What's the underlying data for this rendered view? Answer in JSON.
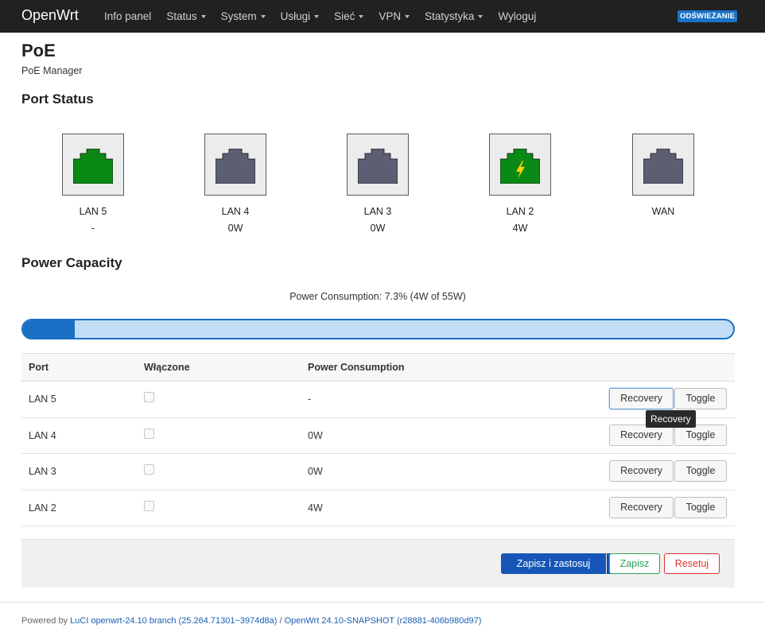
{
  "brand": "OpenWrt",
  "nav": [
    {
      "label": "Info panel",
      "dropdown": false
    },
    {
      "label": "Status",
      "dropdown": true
    },
    {
      "label": "System",
      "dropdown": true
    },
    {
      "label": "Usługi",
      "dropdown": true
    },
    {
      "label": "Sieć",
      "dropdown": true
    },
    {
      "label": "VPN",
      "dropdown": true
    },
    {
      "label": "Statystyka",
      "dropdown": true
    },
    {
      "label": "Wyloguj",
      "dropdown": false
    }
  ],
  "refresh_badge": "ODŚWIEŻANIE",
  "page": {
    "title": "PoE",
    "description": "PoE Manager"
  },
  "port_status": {
    "title": "Port Status",
    "ports": [
      {
        "name": "LAN 5",
        "power": "-",
        "state": "active",
        "color": "#0a8a14",
        "icon": "ethernet-port-icon"
      },
      {
        "name": "LAN 4",
        "power": "0W",
        "state": "inactive",
        "color": "#5c5f73",
        "icon": "ethernet-port-icon"
      },
      {
        "name": "LAN 3",
        "power": "0W",
        "state": "inactive",
        "color": "#5c5f73",
        "icon": "ethernet-port-icon"
      },
      {
        "name": "LAN 2",
        "power": "4W",
        "state": "poe-active",
        "color": "#0a8a14",
        "icon": "ethernet-port-poe-icon"
      },
      {
        "name": "WAN",
        "power": "",
        "state": "inactive",
        "color": "#5c5f73",
        "icon": "ethernet-port-icon"
      }
    ]
  },
  "power_capacity": {
    "title": "Power Capacity",
    "consumption_text": "Power Consumption: 7.3% (4W of 55W)",
    "percent": 7.3
  },
  "table": {
    "headers": {
      "port": "Port",
      "enabled": "Włączone",
      "consumption": "Power Consumption"
    },
    "rows": [
      {
        "port": "LAN 5",
        "enabled": false,
        "consumption": "-",
        "recovery": "Recovery",
        "toggle": "Toggle"
      },
      {
        "port": "LAN 4",
        "enabled": false,
        "consumption": "0W",
        "recovery": "Recovery",
        "toggle": "Toggle"
      },
      {
        "port": "LAN 3",
        "enabled": false,
        "consumption": "0W",
        "recovery": "Recovery",
        "toggle": "Toggle"
      },
      {
        "port": "LAN 2",
        "enabled": false,
        "consumption": "4W",
        "recovery": "Recovery",
        "toggle": "Toggle"
      }
    ],
    "tooltip": "Recovery"
  },
  "actions": {
    "apply": "Zapisz i zastosuj",
    "save": "Zapisz",
    "reset": "Resetuj"
  },
  "footer": {
    "prefix": "Powered by ",
    "luci_link": "LuCI openwrt-24.10 branch (25.264.71301~3974d8a)",
    "separator": " / ",
    "openwrt_link": "OpenWrt 24.10-SNAPSHOT (r28881-406b980d97)"
  },
  "colors": {
    "accent": "#1a6fc4",
    "navbar": "#212121",
    "active_port": "#0a8a14",
    "inactive_port": "#5c5f73",
    "save": "#2aa25a",
    "reset": "#d9342b"
  }
}
